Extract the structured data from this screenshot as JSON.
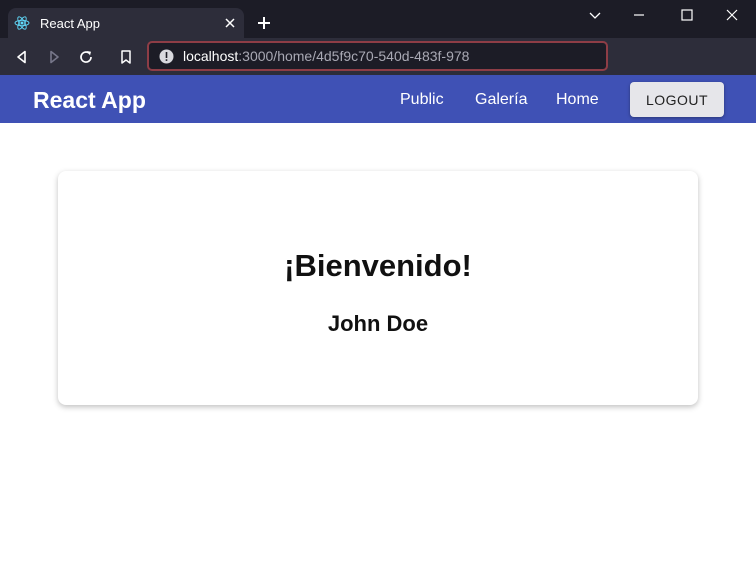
{
  "browser": {
    "tab": {
      "title": "React App"
    },
    "url": {
      "host": "localhost",
      "rest": ":3000/home/4d5f9c70-540d-483f-978"
    }
  },
  "app": {
    "brand": "React App",
    "nav": [
      {
        "label": "Public"
      },
      {
        "label": "Galería"
      },
      {
        "label": "Home"
      }
    ],
    "logout_label": "LOGOUT"
  },
  "content": {
    "welcome": "¡Bienvenido!",
    "user_name": "John Doe"
  },
  "colors": {
    "appbar": "#3f51b5",
    "chrome_dark": "#1c1c26",
    "chrome_tab": "#2d2d3a",
    "url_border": "#8e3d46"
  }
}
